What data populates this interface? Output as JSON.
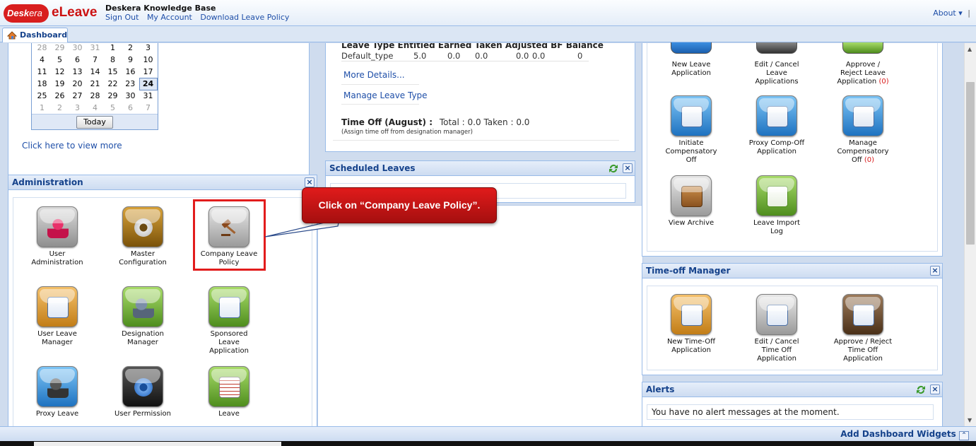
{
  "header": {
    "logo_left": "Desk",
    "logo_right": "era",
    "app_name": "eLeave",
    "kb_title": "Deskera Knowledge Base",
    "links": [
      "Sign Out",
      "My Account",
      "Download Leave Policy"
    ],
    "about": "About",
    "about_sep": "|"
  },
  "tabs": [
    {
      "label": "Dashboard"
    }
  ],
  "calendar": {
    "rows": [
      [
        "28",
        "29",
        "30",
        "31",
        "1",
        "2",
        "3"
      ],
      [
        "4",
        "5",
        "6",
        "7",
        "8",
        "9",
        "10"
      ],
      [
        "11",
        "12",
        "13",
        "14",
        "15",
        "16",
        "17"
      ],
      [
        "18",
        "19",
        "20",
        "21",
        "22",
        "23",
        "24"
      ],
      [
        "25",
        "26",
        "27",
        "28",
        "29",
        "30",
        "31"
      ],
      [
        "1",
        "2",
        "3",
        "4",
        "5",
        "6",
        "7"
      ]
    ],
    "selected": "24",
    "today_label": "Today",
    "view_more": "Click here to view more"
  },
  "leave_summary": {
    "columns": [
      "Leave Type",
      "Entitled",
      "Earned",
      "Taken",
      "Adjusted",
      "BF",
      "Balance"
    ],
    "row": [
      "Default_type",
      "5.0",
      "0.0",
      "0.0",
      "0.0",
      "0.0",
      "0"
    ],
    "more_details": "More Details...",
    "manage_leave_type": "Manage Leave Type",
    "timeoff_label": "Time Off (August) :",
    "timeoff_values": "Total : 0.0 Taken : 0.0",
    "timeoff_note": "(Assign time off from designation manager)"
  },
  "scheduled_leaves": {
    "title": "Scheduled Leaves"
  },
  "administration": {
    "title": "Administration",
    "items": [
      {
        "label": "User Administration",
        "icon": "user-admin-icon"
      },
      {
        "label": "Master Configuration",
        "icon": "gear-icon"
      },
      {
        "label": "Company Leave Policy",
        "icon": "gavel-icon"
      },
      {
        "label": "User Leave Manager",
        "icon": "user-leave-manager-icon"
      },
      {
        "label": "Designation Manager",
        "icon": "designation-icon"
      },
      {
        "label": "Sponsored Leave Application",
        "icon": "sponsored-leave-icon"
      },
      {
        "label": "Proxy Leave Application",
        "icon": "proxy-leave-icon"
      },
      {
        "label": "User Permission",
        "icon": "permission-icon"
      },
      {
        "label": "Leave Adjustment Log",
        "icon": "adjustment-log-icon"
      }
    ]
  },
  "leave_apps": {
    "items": [
      {
        "label": "New Leave Application",
        "count": ""
      },
      {
        "label": "Edit / Cancel Leave Applications",
        "count": ""
      },
      {
        "label": "Approve / Reject Leave Application",
        "count": "(0)"
      },
      {
        "label": "Initiate Compensatory Off",
        "count": ""
      },
      {
        "label": "Proxy Comp-Off Application",
        "count": ""
      },
      {
        "label": "Manage Compensatory Off",
        "count": "(0)"
      },
      {
        "label": "View Archive",
        "count": ""
      },
      {
        "label": "Leave Import Log",
        "count": ""
      }
    ]
  },
  "timeoff_manager": {
    "title": "Time-off Manager",
    "items": [
      {
        "label": "New Time-Off Application"
      },
      {
        "label": "Edit / Cancel Time Off Application"
      },
      {
        "label": "Approve / Reject Time Off Application"
      }
    ]
  },
  "alerts": {
    "title": "Alerts",
    "message": "You have no alert messages at the moment."
  },
  "callout": {
    "text": "Click on “Company Leave Policy”."
  },
  "footer": {
    "add_widgets": "Add Dashboard Widgets"
  },
  "colors": {
    "brand_red": "#d81e1e",
    "header_blue": "#15428b",
    "link_blue": "#1f4fa8",
    "panel_border": "#99bbe8"
  }
}
